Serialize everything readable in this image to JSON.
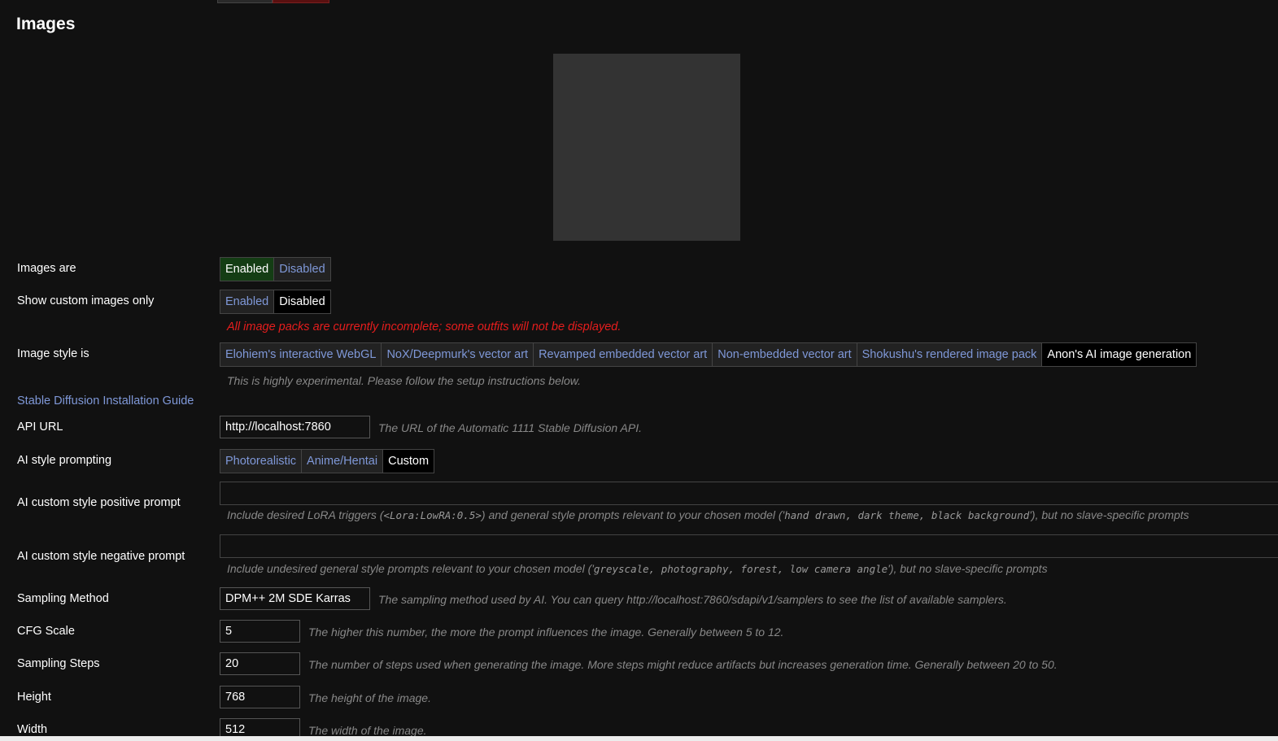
{
  "header": {
    "title": "Images"
  },
  "settings": {
    "images_are": {
      "label": "Images are",
      "options": [
        "Enabled",
        "Disabled"
      ],
      "selected": "Enabled"
    },
    "show_custom_only": {
      "label": "Show custom images only",
      "options": [
        "Enabled",
        "Disabled"
      ],
      "selected": "Disabled"
    },
    "warning": "All image packs are currently incomplete; some outfits will not be displayed.",
    "image_style": {
      "label": "Image style is",
      "options": [
        "Elohiem's interactive WebGL",
        "NoX/Deepmurk's vector art",
        "Revamped embedded vector art",
        "Non-embedded vector art",
        "Shokushu's rendered image pack",
        "Anon's AI image generation"
      ],
      "selected": "Anon's AI image generation",
      "note": "This is highly experimental. Please follow the setup instructions below."
    },
    "guide_link": "Stable Diffusion Installation Guide",
    "api_url": {
      "label": "API URL",
      "value": "http://localhost:7860",
      "note": "The URL of the Automatic 1111 Stable Diffusion API."
    },
    "ai_style": {
      "label": "AI style prompting",
      "options": [
        "Photorealistic",
        "Anime/Hentai",
        "Custom"
      ],
      "selected": "Custom"
    },
    "positive_prompt": {
      "label": "AI custom style positive prompt",
      "value": "",
      "note_1": "Include desired LoRA triggers (",
      "note_code_1": "<Lora:LowRA:0.5>",
      "note_2": ") and general style prompts relevant to your chosen model ('",
      "note_code_2": "hand drawn, dark theme, black background",
      "note_3": "'), but no slave-specific prompts"
    },
    "negative_prompt": {
      "label": "AI custom style negative prompt",
      "value": "",
      "note_1": "Include undesired general style prompts relevant to your chosen model ('",
      "note_code_1": "greyscale, photography, forest, low camera angle",
      "note_2": "'), but no slave-specific prompts"
    },
    "sampling_method": {
      "label": "Sampling Method",
      "value": "DPM++ 2M SDE Karras",
      "note": "The sampling method used by AI. You can query http://localhost:7860/sdapi/v1/samplers to see the list of available samplers."
    },
    "cfg_scale": {
      "label": "CFG Scale",
      "value": "5",
      "note": "The higher this number, the more the prompt influences the image. Generally between 5 to 12."
    },
    "sampling_steps": {
      "label": "Sampling Steps",
      "value": "20",
      "note": "The number of steps used when generating the image. More steps might reduce artifacts but increases generation time. Generally between 20 to 50."
    },
    "height": {
      "label": "Height",
      "value": "768",
      "note": "The height of the image."
    },
    "width": {
      "label": "Width",
      "value": "512",
      "note": "The width of the image."
    }
  },
  "colors": {
    "background": "#111111",
    "link": "#7f98d8",
    "enabled_active": "#143d14",
    "warning": "#e61d1d",
    "preview": "#333333"
  }
}
